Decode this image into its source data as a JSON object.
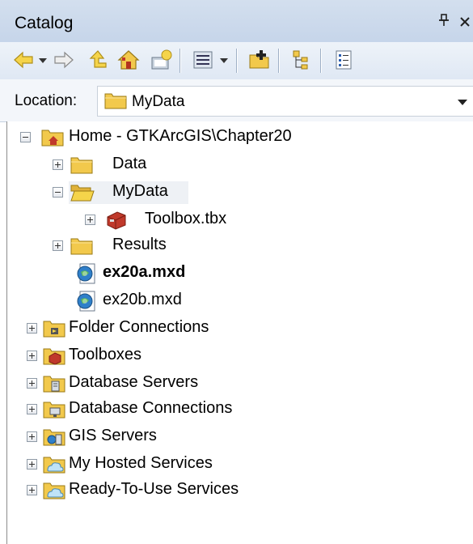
{
  "window": {
    "title": "Catalog"
  },
  "title_controls": {
    "pin": "†",
    "close": "×"
  },
  "toolbar": {
    "buttons": [
      {
        "name": "back-icon"
      },
      {
        "name": "forward-icon"
      },
      {
        "name": "up-one-level-icon"
      },
      {
        "name": "home-icon"
      },
      {
        "name": "toggle-contents-icon"
      },
      {
        "name": "views-icon"
      },
      {
        "name": "connect-to-folder-icon"
      },
      {
        "name": "tree-icon"
      },
      {
        "name": "options-icon"
      }
    ]
  },
  "location": {
    "label": "Location:",
    "value": "MyData"
  },
  "tree": {
    "home": {
      "label": "Home - GTKArcGIS\\Chapter20"
    },
    "data": {
      "label": "Data"
    },
    "mydata": {
      "label": "MyData"
    },
    "toolbox_tbx": {
      "label": "Toolbox.tbx"
    },
    "results": {
      "label": "Results"
    },
    "ex20a": {
      "label": "ex20a.mxd"
    },
    "ex20b": {
      "label": "ex20b.mxd"
    },
    "folder_connections": {
      "label": "Folder Connections"
    },
    "toolboxes": {
      "label": "Toolboxes"
    },
    "database_servers": {
      "label": "Database Servers"
    },
    "database_connections": {
      "label": "Database Connections"
    },
    "gis_servers": {
      "label": "GIS Servers"
    },
    "my_hosted_services": {
      "label": "My Hosted Services"
    },
    "ready_to_use_services": {
      "label": "Ready-To-Use Services"
    }
  }
}
